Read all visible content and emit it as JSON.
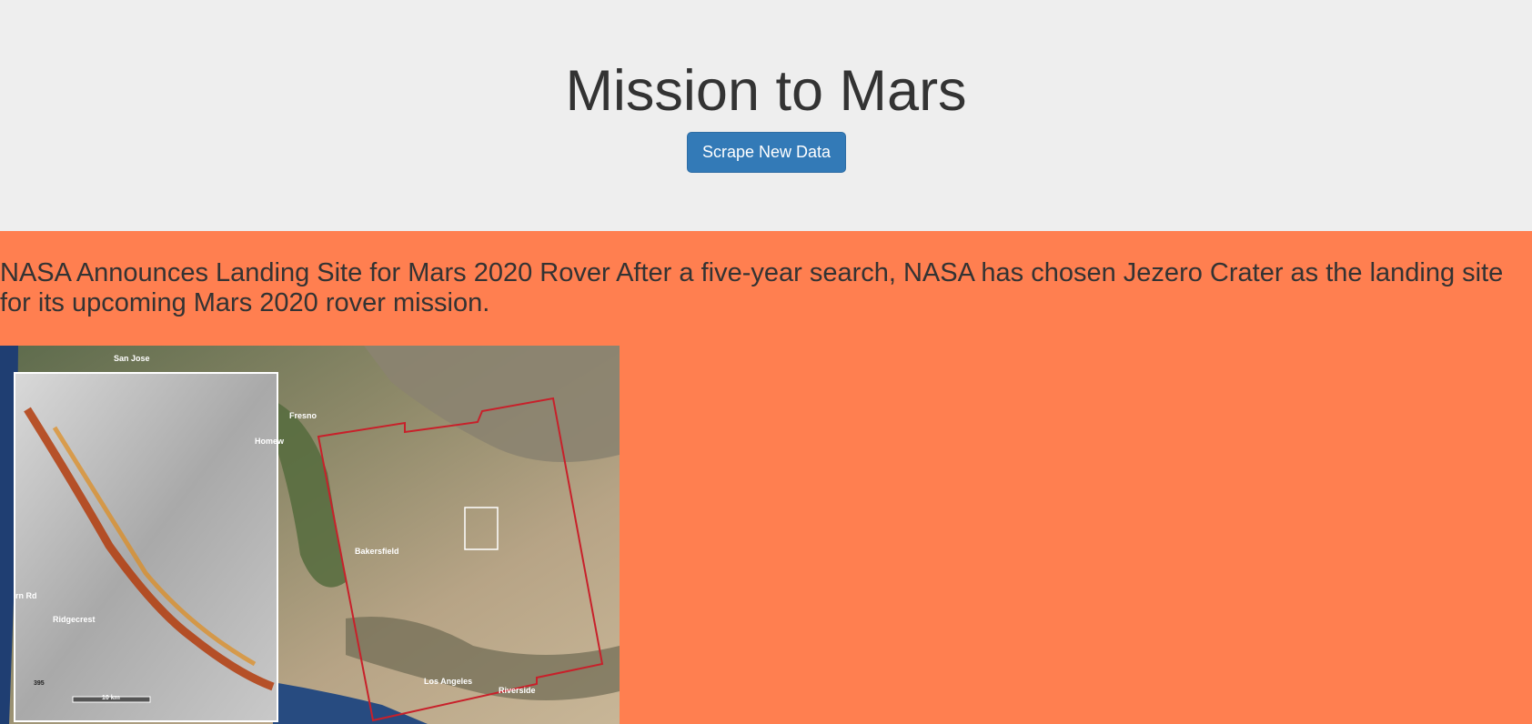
{
  "header": {
    "title": "Mission to Mars",
    "scrape_button_label": "Scrape New Data"
  },
  "news": {
    "title": "NASA Announces Landing Site for Mars 2020 Rover",
    "paragraph": "After a five-year search, NASA has chosen Jezero Crater as the landing site for its upcoming Mars 2020 rover mission."
  },
  "featured_image": {
    "map_labels": {
      "san_jose": "San Jose",
      "fresno": "Fresno",
      "bakersfield": "Bakersfield",
      "los_angeles": "Los Angeles",
      "riverside": "Riverside",
      "homewood": "Homew",
      "ridgecrest": "Ridgecrest",
      "road": "rn Rd",
      "scale": "10 km",
      "hwy": "395"
    }
  },
  "colors": {
    "header_bg": "#eeeeee",
    "section_bg": "#ff7f50",
    "button_bg": "#337ab7"
  }
}
